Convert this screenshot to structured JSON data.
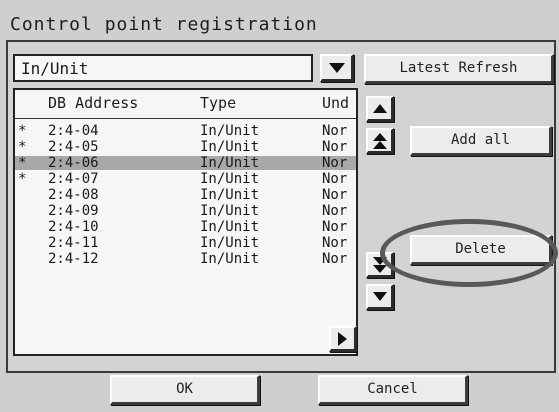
{
  "dialog": {
    "title": "Control point registration"
  },
  "combo": {
    "value": "In/Unit"
  },
  "buttons": {
    "latest_refresh": "Latest Refresh",
    "add_all": "Add all",
    "delete": "Delete",
    "ok": "OK",
    "cancel": "Cancel"
  },
  "list": {
    "columns": [
      "DB Address",
      "Type",
      "Und"
    ],
    "rows": [
      {
        "mark": "*",
        "address": "2:4-04",
        "type": "In/Unit",
        "und": "Nor",
        "selected": false
      },
      {
        "mark": "*",
        "address": "2:4-05",
        "type": "In/Unit",
        "und": "Nor",
        "selected": false
      },
      {
        "mark": "*",
        "address": "2:4-06",
        "type": "In/Unit",
        "und": "Nor",
        "selected": true
      },
      {
        "mark": "*",
        "address": "2:4-07",
        "type": "In/Unit",
        "und": "Nor",
        "selected": false
      },
      {
        "mark": "",
        "address": "2:4-08",
        "type": "In/Unit",
        "und": "Nor",
        "selected": false
      },
      {
        "mark": "",
        "address": "2:4-09",
        "type": "In/Unit",
        "und": "Nor",
        "selected": false
      },
      {
        "mark": "",
        "address": "2:4-10",
        "type": "In/Unit",
        "und": "Nor",
        "selected": false
      },
      {
        "mark": "",
        "address": "2:4-11",
        "type": "In/Unit",
        "und": "Nor",
        "selected": false
      },
      {
        "mark": "",
        "address": "2:4-12",
        "type": "In/Unit",
        "und": "Nor",
        "selected": false
      }
    ]
  },
  "icons": {
    "combo_dropdown": "triangle-down-icon",
    "scroll_up": "triangle-up-icon",
    "page_up": "double-triangle-up-icon",
    "page_down": "double-triangle-down-icon",
    "scroll_down": "triangle-down-icon",
    "scroll_right": "triangle-right-icon"
  },
  "annotation": {
    "shape": "ellipse",
    "highlights": "delete-button",
    "color": "#595959"
  }
}
